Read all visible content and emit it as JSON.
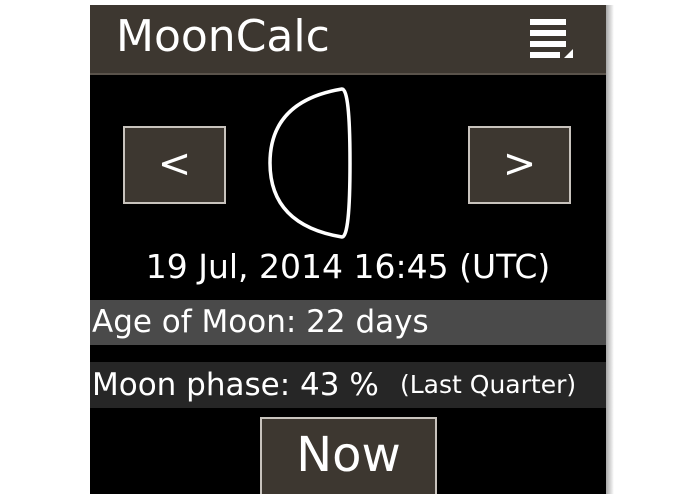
{
  "app": {
    "title": "MoonCalc"
  },
  "navigation": {
    "prev_label": "<",
    "next_label": ">"
  },
  "moon": {
    "datetime": "19 Jul, 2014 16:45 (UTC)",
    "age_text": "Age of Moon: 22 days",
    "phase_text": "Moon phase: 43 %",
    "phase_name": "(Last Quarter)",
    "phase_icon": "moon-phase-icon"
  },
  "actions": {
    "now_label": "Now"
  },
  "icons": {
    "menu": "menu-icon"
  },
  "colors": {
    "app_bar": "#3d3730",
    "background": "#000000",
    "age_row": "#4a4a4a",
    "phase_row": "#262626",
    "button_border": "#c8c3bd",
    "text": "#ffffff"
  }
}
